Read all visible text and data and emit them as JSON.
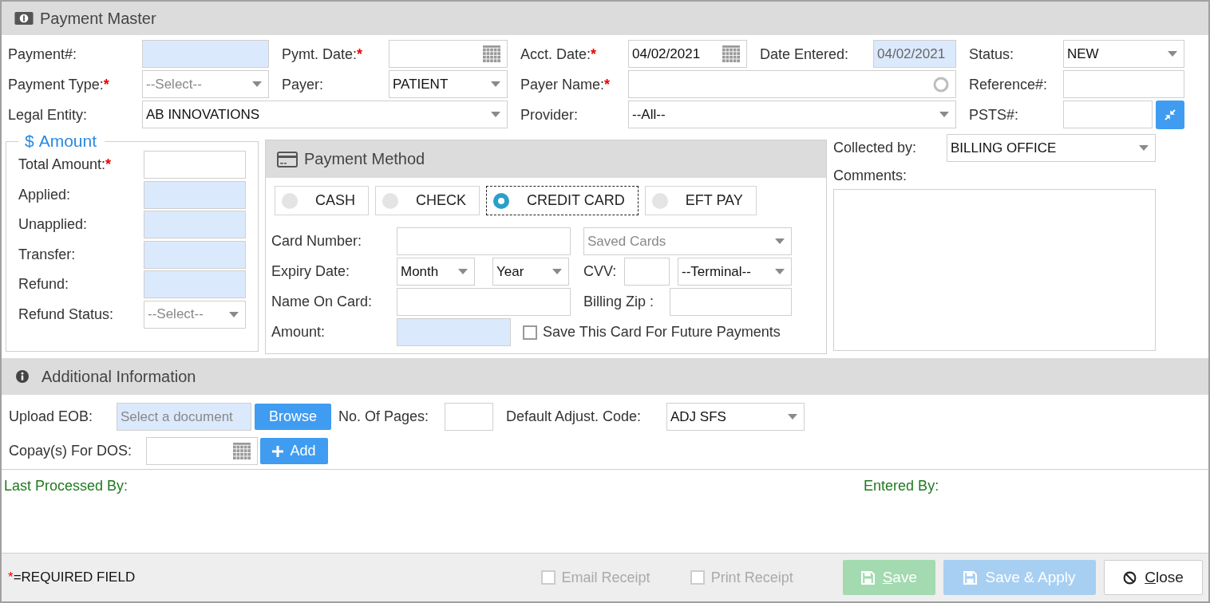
{
  "window": {
    "title": "Payment Master"
  },
  "top_form": {
    "fields": [
      {
        "label": "Payment#:",
        "kind": "text",
        "readonly": true
      },
      {
        "label": "Pymt. Date:",
        "required_mark": "*",
        "kind": "date",
        "readonly": false
      },
      {
        "label": "Acct. Date:",
        "required_mark": "*",
        "kind": "date",
        "value": "04/02/2021",
        "readonly": false
      },
      {
        "label": "Date Entered:",
        "kind": "text",
        "value": "04/02/2021",
        "readonly": true
      },
      {
        "label": "Status:",
        "kind": "select",
        "value": "NEW",
        "readonly": false
      },
      {
        "label": "Payment Type:",
        "required_mark": "*",
        "kind": "select",
        "placeholder": "--Select--",
        "readonly": false
      },
      {
        "label": "Payer:",
        "kind": "select",
        "value": "PATIENT",
        "readonly": false
      },
      {
        "label": "Payer Name:",
        "required_mark": "*",
        "kind": "search",
        "readonly": false
      },
      {
        "label": "Reference#:",
        "kind": "text",
        "readonly": false
      },
      {
        "label": "Legal Entity:",
        "kind": "select",
        "value": "AB INNOVATIONS",
        "readonly": false
      },
      {
        "label": "Provider:",
        "kind": "select",
        "value": "--All--",
        "readonly": false
      },
      {
        "label": "PSTS#:",
        "kind": "text_action",
        "readonly": false
      }
    ]
  },
  "amount": {
    "legend_icon": "$",
    "title": "Amount",
    "rows": [
      {
        "label": "Total Amount:",
        "required_mark": "*",
        "kind": "text",
        "readonly": false
      },
      {
        "label": "Applied:",
        "kind": "text",
        "readonly": true
      },
      {
        "label": "Unapplied:",
        "kind": "text",
        "readonly": true
      },
      {
        "label": "Transfer:",
        "kind": "text",
        "readonly": true
      },
      {
        "label": "Refund:",
        "kind": "text",
        "readonly": true
      },
      {
        "label": "Refund Status:",
        "kind": "select",
        "placeholder": "--Select--",
        "readonly": false
      }
    ]
  },
  "payment_method": {
    "title": "Payment Method",
    "options": [
      {
        "label": "CASH",
        "selected": false
      },
      {
        "label": "CHECK",
        "selected": false
      },
      {
        "label": "CREDIT CARD",
        "selected": true
      },
      {
        "label": "EFT PAY",
        "selected": false
      }
    ],
    "rows": [
      [
        {
          "kind": "label",
          "text": "Card Number:"
        },
        {
          "kind": "text",
          "readonly": false
        },
        {
          "kind": "select",
          "placeholder": "Saved Cards",
          "readonly": false
        }
      ],
      [
        {
          "kind": "label",
          "text": "Expiry Date:"
        },
        {
          "kind": "select",
          "value": "Month",
          "readonly": false
        },
        {
          "kind": "select",
          "value": "Year",
          "readonly": false
        },
        {
          "kind": "label",
          "text": "CVV:"
        },
        {
          "kind": "text",
          "readonly": false
        },
        {
          "kind": "select",
          "value": "--Terminal--",
          "readonly": false
        }
      ],
      [
        {
          "kind": "label",
          "text": "Name On Card:"
        },
        {
          "kind": "text",
          "readonly": false
        },
        {
          "kind": "label",
          "text": "Billing Zip :"
        },
        {
          "kind": "text",
          "readonly": false
        }
      ],
      [
        {
          "kind": "label",
          "text": "Amount:"
        },
        {
          "kind": "text",
          "readonly": true
        },
        {
          "kind": "checkbox",
          "text": "Save This Card For Future Payments",
          "checked": false
        }
      ]
    ]
  },
  "collected_by": {
    "label": "Collected by:",
    "kind": "select",
    "value": "BILLING OFFICE",
    "readonly": false
  },
  "comments": {
    "label": "Comments:"
  },
  "additional_info": {
    "title": "Additional Information",
    "rows": [
      [
        {
          "kind": "label",
          "text": "Upload EOB:"
        },
        {
          "kind": "file",
          "placeholder": "Select a document",
          "readonly": true
        },
        {
          "kind": "button",
          "text": "Browse"
        },
        {
          "kind": "label",
          "text": "No. Of Pages:"
        },
        {
          "kind": "text",
          "readonly": false
        },
        {
          "kind": "label",
          "text": "Default Adjust. Code:"
        },
        {
          "kind": "select",
          "value": "ADJ SFS",
          "readonly": false
        }
      ],
      [
        {
          "kind": "label",
          "text": "Copay(s) For DOS:"
        },
        {
          "kind": "date",
          "readonly": false
        },
        {
          "kind": "add_button",
          "text": "Add"
        }
      ]
    ]
  },
  "audit": {
    "last_processed_by": "Last Processed By:",
    "entered_by": "Entered By:"
  },
  "footer": {
    "required_mark": "*",
    "required_note": "=REQUIRED FIELD",
    "checkboxes": [
      {
        "label": "Email Receipt",
        "checked": false,
        "disabled": true
      },
      {
        "label": "Print Receipt",
        "checked": false,
        "disabled": true
      }
    ],
    "buttons": [
      {
        "label": "Save",
        "kind": "success",
        "disabled": true,
        "underlined_key": true
      },
      {
        "label": "Save & Apply",
        "kind": "primary",
        "disabled": true,
        "underlined_key": false
      },
      {
        "label": "Close",
        "kind": "default",
        "disabled": false,
        "underlined_key": true
      }
    ]
  }
}
